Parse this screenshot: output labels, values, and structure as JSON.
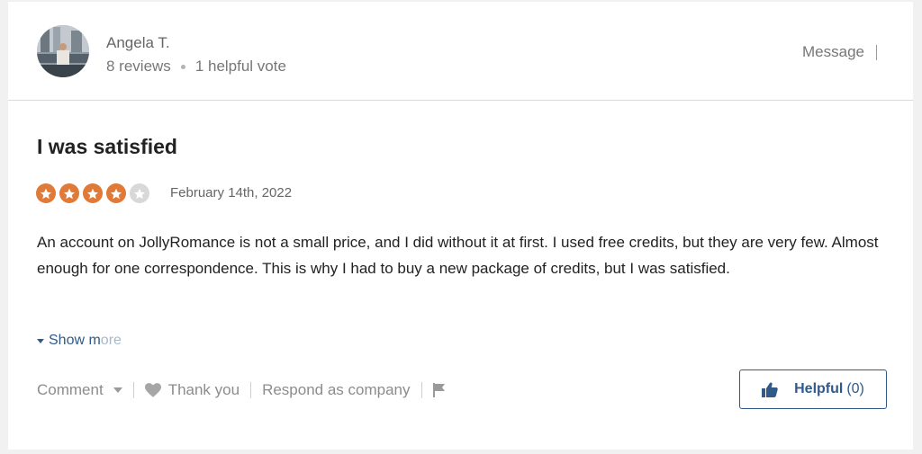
{
  "reviewer": {
    "name": "Angela T.",
    "reviews": "8 reviews",
    "helpful_votes": "1 helpful vote",
    "message_label": "Message"
  },
  "review": {
    "title": "I was satisfied",
    "rating": 4,
    "max_rating": 5,
    "date": "February 14th, 2022",
    "body": "An account on JollyRomance is not a small price, and I did without it at first. I used free credits, but they are very few. Almost enough for one correspondence. This is why I had to buy a new package of credits, but I was satisfied.",
    "show_more_main": "Show m",
    "show_more_fade": "ore"
  },
  "actions": {
    "comment_label": "Comment",
    "thank_label": "Thank you",
    "respond_label": "Respond as company",
    "helpful_label": "Helpful",
    "helpful_count": "(0)"
  },
  "icons": {
    "star": "star-icon",
    "heart": "heart-icon",
    "flag": "flag-icon",
    "thumbs_up": "thumbs-up-icon"
  },
  "colors": {
    "star_filled": "#e07a36",
    "star_empty": "#d8d8d8",
    "accent": "#2f5a8a"
  }
}
